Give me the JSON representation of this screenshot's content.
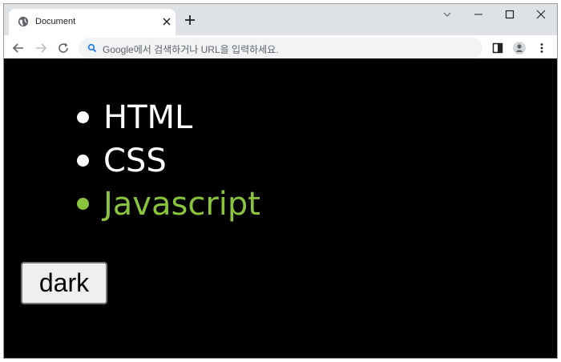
{
  "browser": {
    "tab": {
      "title": "Document",
      "favicon": "globe-icon"
    },
    "omnibox": {
      "placeholder": "Google에서 검색하거나 URL을 입력하세요."
    }
  },
  "page": {
    "list_items": [
      {
        "label": "HTML",
        "color": "#ffffff"
      },
      {
        "label": "CSS",
        "color": "#ffffff"
      },
      {
        "label": "Javascript",
        "color": "#8ac33c"
      }
    ],
    "mode_button_label": "dark"
  },
  "colors": {
    "page_background": "#000000",
    "highlight": "#8ac33c"
  }
}
